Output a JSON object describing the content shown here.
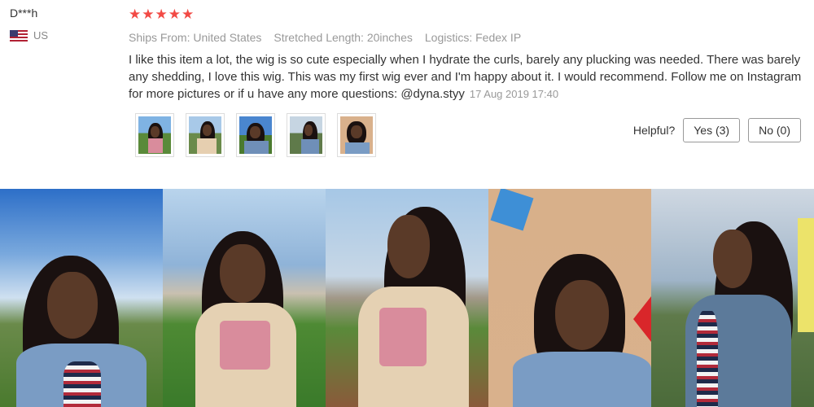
{
  "reviewer": {
    "name": "D***h",
    "country": "US"
  },
  "review": {
    "rating": 5,
    "stars": "★★★★★",
    "ships_from": "Ships From: United States",
    "stretched_length": "Stretched Length: 20inches",
    "logistics": "Logistics: Fedex IP",
    "text": "I like this item a lot, the wig is so cute especially when I hydrate the curls, barely any plucking was needed. There was barely any shedding, I love this wig. This was my first wig ever and I'm happy about it. I would recommend. Follow me on Instagram for more pictures or if u have any more questions: @dyna.styy",
    "date": "17 Aug 2019 17:40"
  },
  "helpful": {
    "label": "Helpful?",
    "yes": "Yes (3)",
    "no": "No (0)"
  },
  "colors": {
    "star": "#f24a45",
    "meta_text": "#999999",
    "body_text": "#333333"
  }
}
